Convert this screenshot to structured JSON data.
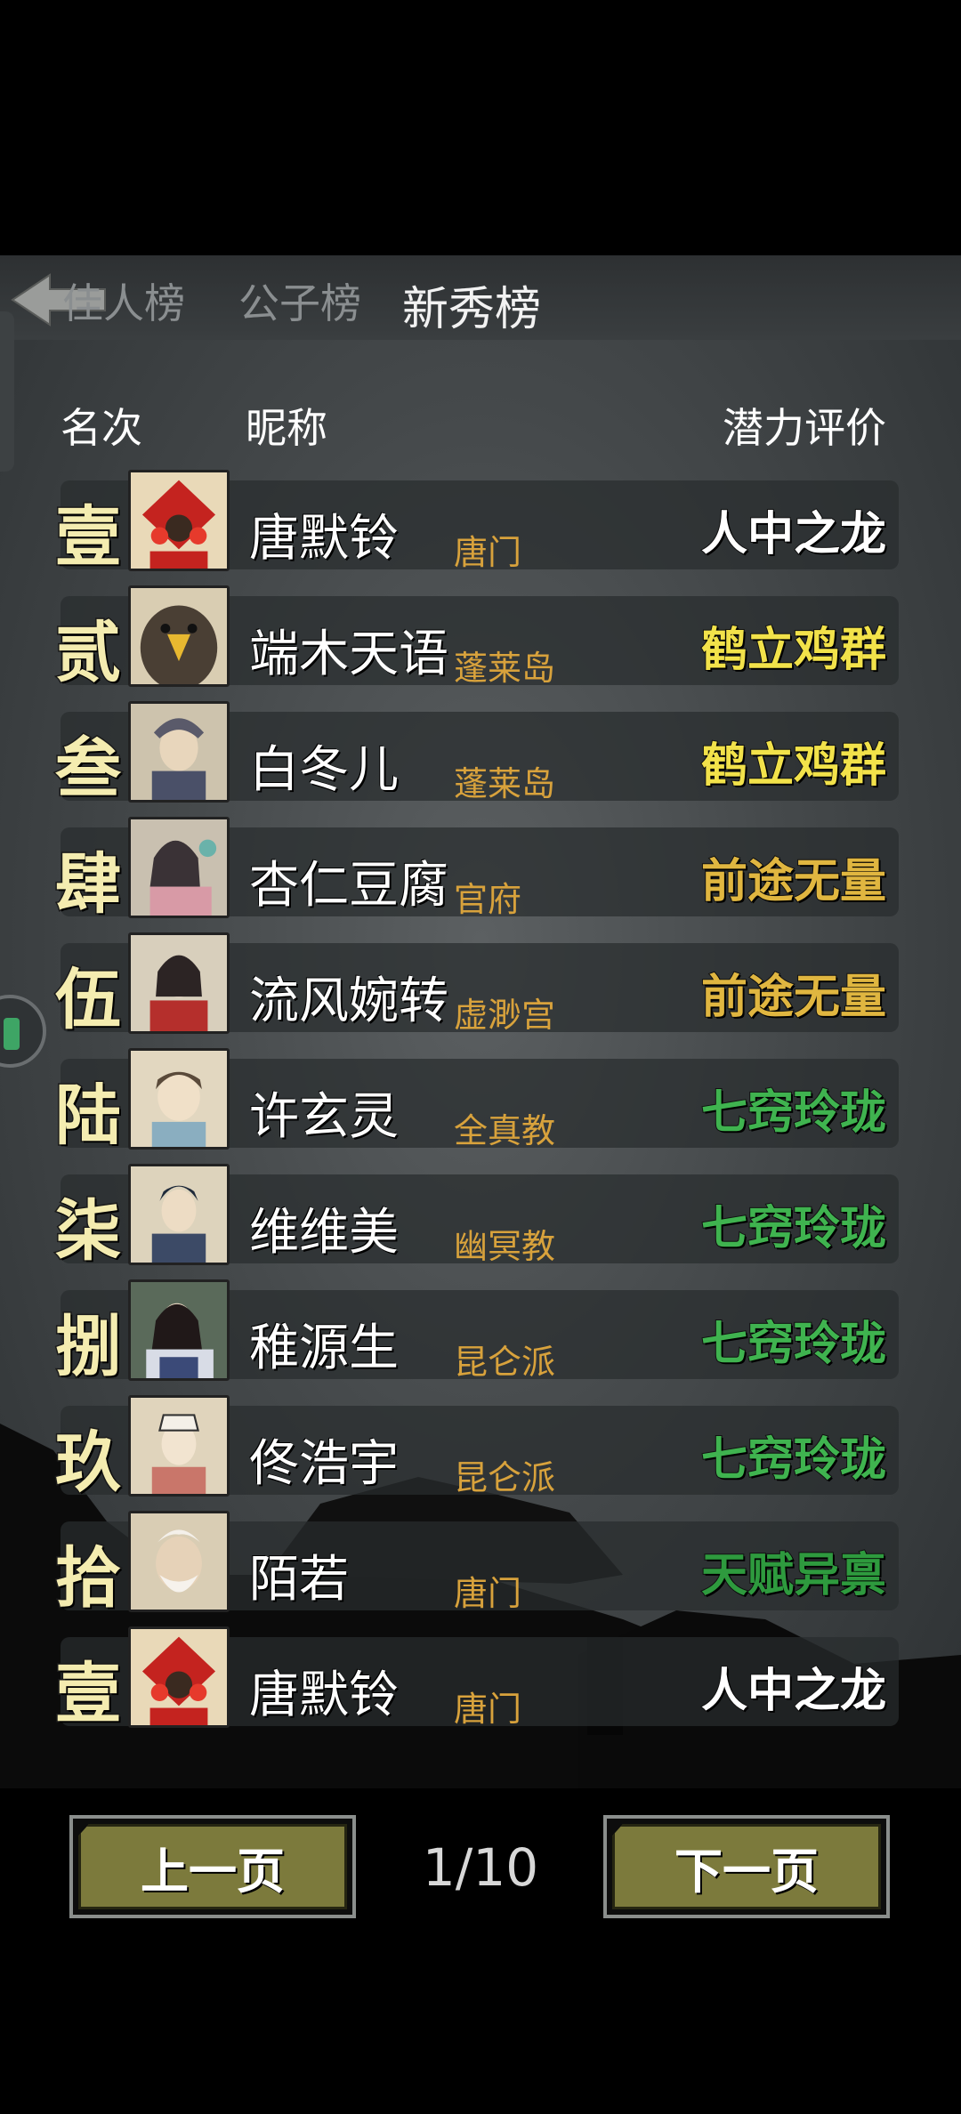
{
  "tabs": [
    {
      "label": "佳人榜",
      "state": "dim"
    },
    {
      "label": "公子榜",
      "state": "dim"
    },
    {
      "label": "新秀榜",
      "state": "active"
    }
  ],
  "headers": {
    "rank": "名次",
    "nickname": "昵称",
    "rating": "潜力评价"
  },
  "rows": [
    {
      "rank": "壹",
      "name": "唐默铃",
      "sect": "唐门",
      "rating": "人中之龙",
      "rating_color": "#ffffff",
      "avatar": "red-seal"
    },
    {
      "rank": "贰",
      "name": "端木天语",
      "sect": "蓬莱岛",
      "rating": "鹤立鸡群",
      "rating_color": "#f2e24a",
      "avatar": "eagle"
    },
    {
      "rank": "叁",
      "name": "白冬儿",
      "sect": "蓬莱岛",
      "rating": "鹤立鸡群",
      "rating_color": "#f2e24a",
      "avatar": "warrior"
    },
    {
      "rank": "肆",
      "name": "杏仁豆腐",
      "sect": "官府",
      "rating": "前途无量",
      "rating_color": "#e0b640",
      "avatar": "lady-pink"
    },
    {
      "rank": "伍",
      "name": "流风婉转",
      "sect": "虚渺宫",
      "rating": "前途无量",
      "rating_color": "#e0b640",
      "avatar": "lady-red"
    },
    {
      "rank": "陆",
      "name": "许玄灵",
      "sect": "全真教",
      "rating": "七窍玲珑",
      "rating_color": "#3fb34f",
      "avatar": "boy-blue"
    },
    {
      "rank": "柒",
      "name": "维维美",
      "sect": "幽冥教",
      "rating": "七窍玲珑",
      "rating_color": "#3fb34f",
      "avatar": "boy-dark"
    },
    {
      "rank": "捌",
      "name": "稚源生",
      "sect": "昆仑派",
      "rating": "七窍玲珑",
      "rating_color": "#3fb34f",
      "avatar": "lady-fur"
    },
    {
      "rank": "玖",
      "name": "佟浩宇",
      "sect": "昆仑派",
      "rating": "七窍玲珑",
      "rating_color": "#3fb34f",
      "avatar": "scholar"
    },
    {
      "rank": "拾",
      "name": "陌若",
      "sect": "唐门",
      "rating": "天赋异禀",
      "rating_color": "#2e9a3e",
      "avatar": "monk"
    },
    {
      "rank": "壹",
      "name": "唐默铃",
      "sect": "唐门",
      "rating": "人中之龙",
      "rating_color": "#ffffff",
      "avatar": "red-seal"
    }
  ],
  "pagination": {
    "prev_label": "上一页",
    "page_text": "1/10",
    "next_label": "下一页"
  },
  "colors": {
    "sect": "#d8a23c",
    "button": "#7c7a3c",
    "rank": "#f4ecb0"
  }
}
